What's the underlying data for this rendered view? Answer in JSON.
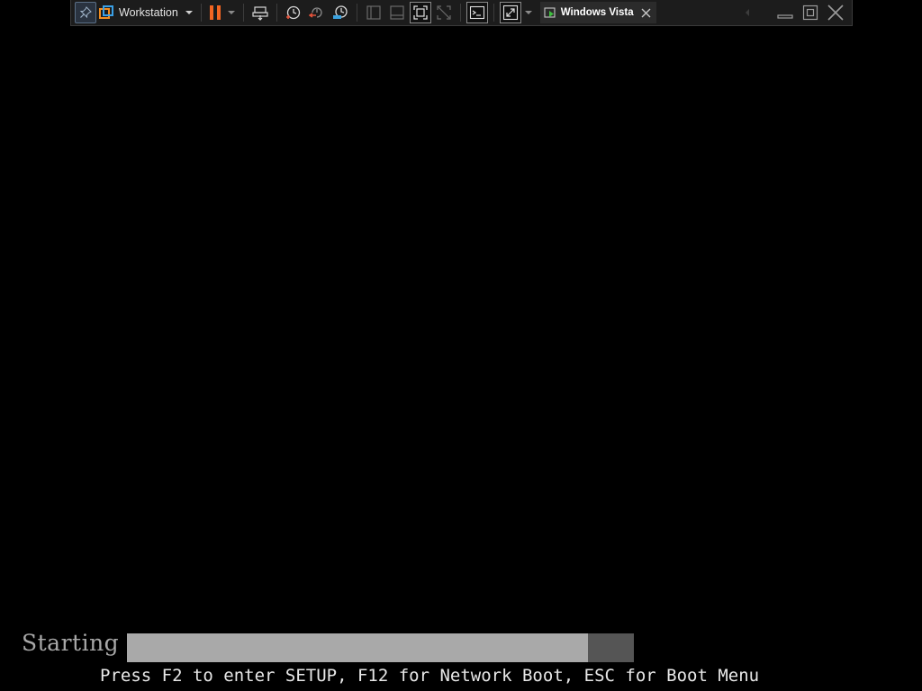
{
  "toolbar": {
    "app_name": "Workstation",
    "vm_tab_label": "Windows Vista",
    "icons": {
      "pin": "pin-icon",
      "app_logo": "vmware-logo-icon",
      "app_menu": "chevron-down-icon",
      "pause": "pause-icon",
      "power_menu": "chevron-down-icon",
      "send_keys": "send-ctrl-alt-del-icon",
      "snapshot": "snapshot-icon",
      "revert": "revert-snapshot-icon",
      "manage_snapshots": "manage-snapshots-icon",
      "library": "show-library-icon",
      "thumbnail": "thumbnail-bar-icon",
      "fullscreen": "full-screen-icon",
      "unity": "unity-icon",
      "console": "console-view-icon",
      "stretch": "stretch-guest-icon",
      "stretch_menu": "chevron-down-icon",
      "tab_vm": "vm-running-icon",
      "tab_close": "close-icon",
      "tab_prev": "chevron-left-icon",
      "minimize": "minimize-icon",
      "restore": "restore-icon",
      "exit": "close-icon"
    },
    "colors": {
      "pause_accent": "#f26522",
      "snapshot_accent": "#e2533b",
      "manage_accent": "#3ba3e0"
    }
  },
  "boot": {
    "status_label": "Starting",
    "progress": 0.91,
    "hint": "Press F2 to enter SETUP, F12 for Network Boot, ESC for Boot Menu"
  }
}
